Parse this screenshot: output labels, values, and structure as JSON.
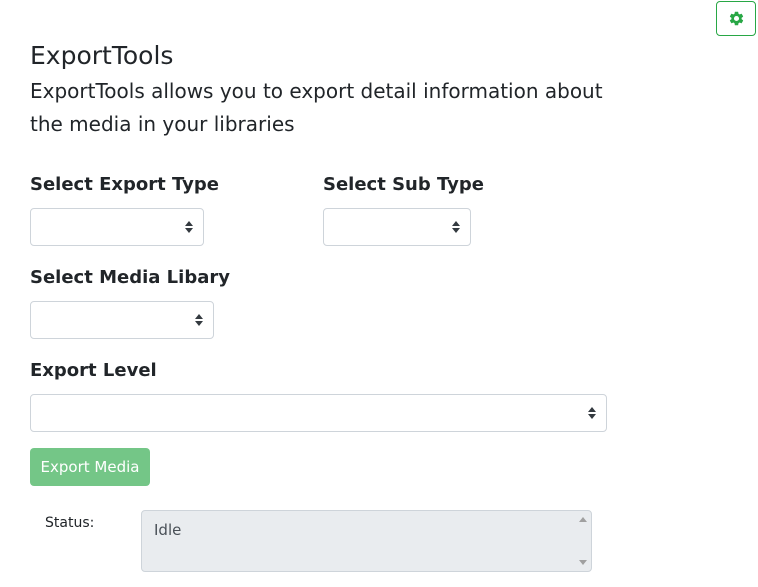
{
  "header": {
    "title": "ExportTools",
    "description": "ExportTools allows you to export detail information about the media in your libraries"
  },
  "settings_button": {
    "icon": "gear-icon",
    "color": "#28a745"
  },
  "form": {
    "export_type": {
      "label": "Select Export Type",
      "value": ""
    },
    "sub_type": {
      "label": "Select Sub Type",
      "value": ""
    },
    "media_library": {
      "label": "Select Media Libary",
      "value": ""
    },
    "export_level": {
      "label": "Export Level",
      "value": ""
    }
  },
  "export_button": {
    "label": "Export Media",
    "color": "#74c687"
  },
  "status": {
    "label": "Status:",
    "value": "Idle"
  }
}
